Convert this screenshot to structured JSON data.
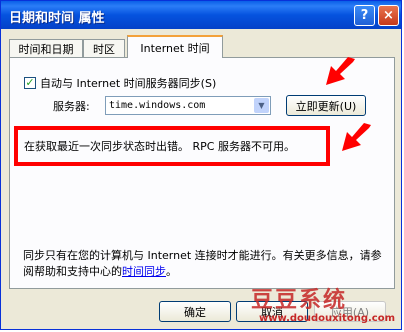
{
  "window": {
    "title": "日期和时间 属性",
    "help_icon": "?",
    "close_icon": "×"
  },
  "tabs": [
    "时间和日期",
    "时区",
    "Internet 时间"
  ],
  "sync": {
    "checkbox_label": "自动与 Internet 时间服务器同步(S)",
    "checked": true
  },
  "server": {
    "label": "服务器:",
    "value": "time.windows.com",
    "update_button": "立即更新(U)"
  },
  "status_message": "在获取最近一次同步状态时出错。 RPC 服务器不可用。",
  "info": {
    "text": "同步只有在您的计算机与 Internet 连接时才能进行。有关更多信息，请参阅帮助和支持中心的",
    "link": "时间同步",
    "suffix": "。"
  },
  "buttons": {
    "ok": "确定",
    "cancel": "取消",
    "apply": "应用(A)"
  },
  "watermark": {
    "brand": "豆豆系统",
    "url": "www.doudouxitong.com"
  }
}
